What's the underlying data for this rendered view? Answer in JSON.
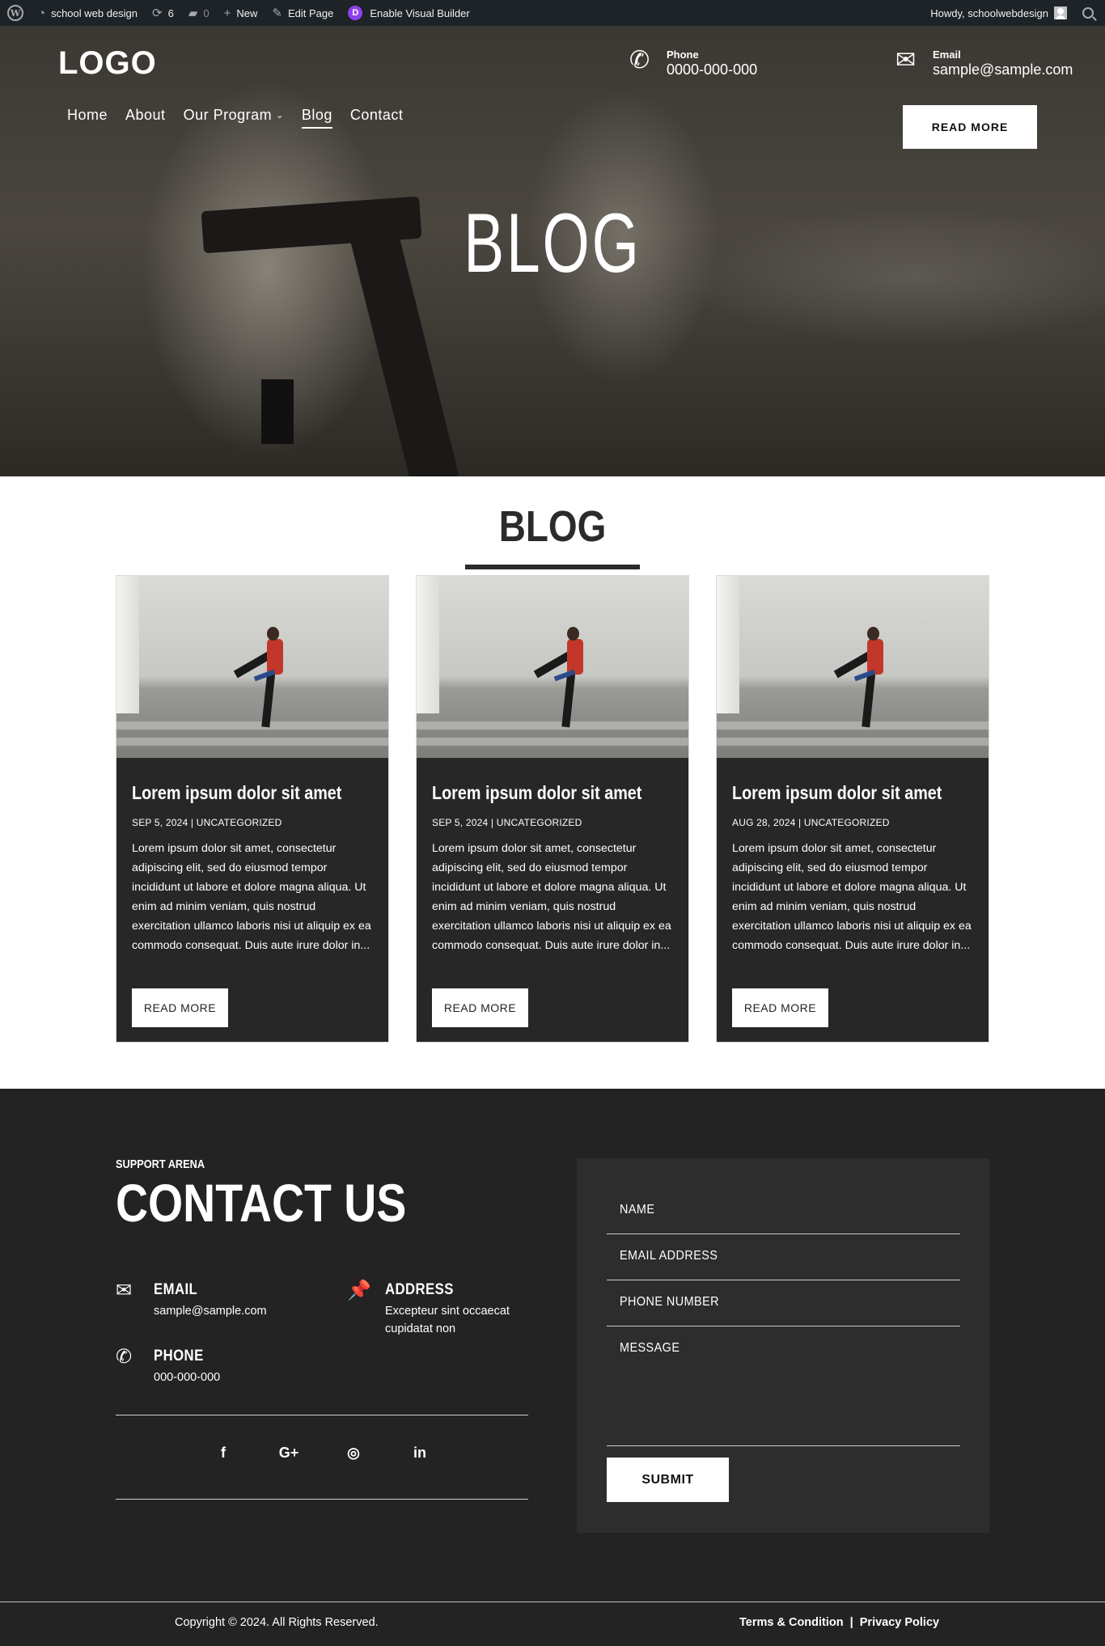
{
  "admin_bar": {
    "site_name": "school web design",
    "updates_count": "6",
    "comments_count": "0",
    "new_label": "New",
    "edit_label": "Edit Page",
    "visual_builder_label": "Enable Visual Builder",
    "greeting": "Howdy, schoolwebdesign"
  },
  "header": {
    "logo": "LOGO",
    "nav": [
      "Home",
      "About",
      "Our Program",
      "Blog",
      "Contact"
    ],
    "active_nav": "Blog",
    "phone_label": "Phone",
    "phone_value": "0000-000-000",
    "email_label": "Email",
    "email_value": "sample@sample.com",
    "cta_label": "READ MORE"
  },
  "hero": {
    "title": "BLOG"
  },
  "blog": {
    "heading": "BLOG",
    "posts": [
      {
        "title": "Lorem ipsum dolor sit amet",
        "date": "SEP 5, 2024",
        "category": "UNCATEGORIZED",
        "excerpt": "Lorem ipsum dolor sit amet, consectetur adipiscing elit, sed do eiusmod tempor incididunt ut labore et dolore magna aliqua. Ut enim ad minim veniam, quis nostrud exercitation ullamco laboris nisi ut aliquip ex ea commodo consequat. Duis aute irure dolor in...",
        "button": "READ MORE"
      },
      {
        "title": "Lorem ipsum dolor sit amet",
        "date": "SEP 5, 2024",
        "category": "UNCATEGORIZED",
        "excerpt": "Lorem ipsum dolor sit amet, consectetur adipiscing elit, sed do eiusmod tempor incididunt ut labore et dolore magna aliqua. Ut enim ad minim veniam, quis nostrud exercitation ullamco laboris nisi ut aliquip ex ea commodo consequat. Duis aute irure dolor in...",
        "button": "READ MORE"
      },
      {
        "title": "Lorem ipsum dolor sit amet",
        "date": "AUG 28, 2024",
        "category": "UNCATEGORIZED",
        "excerpt": "Lorem ipsum dolor sit amet, consectetur adipiscing elit, sed do eiusmod tempor incididunt ut labore et dolore magna aliqua. Ut enim ad minim veniam, quis nostrud exercitation ullamco laboris nisi ut aliquip ex ea commodo consequat. Duis aute irure dolor in...",
        "button": "READ MORE"
      }
    ]
  },
  "contact": {
    "eyebrow": "SUPPORT ARENA",
    "title": "CONTACT US",
    "email_heading": "EMAIL",
    "email_value": "sample@sample.com",
    "address_heading": "ADDRESS",
    "address_value": "Excepteur sint occaecat cupidatat non",
    "phone_heading": "PHONE",
    "phone_value": "000-000-000",
    "social_icons": [
      "facebook-icon",
      "google-plus-icon",
      "instagram-icon",
      "linkedin-icon"
    ]
  },
  "form": {
    "name_placeholder": "NAME",
    "email_placeholder": "EMAIL ADDRESS",
    "phone_placeholder": "PHONE NUMBER",
    "message_placeholder": "MESSAGE",
    "submit_label": "SUBMIT"
  },
  "footer": {
    "copyright": "Copyright © 2024. All Rights Reserved.",
    "terms": "Terms & Condition",
    "separator": "|",
    "privacy": "Privacy Policy"
  },
  "colors": {
    "admin_bar": "#1d2327",
    "card_bg": "#272727",
    "footer_bg": "#232323",
    "form_bg": "#2d2d2d",
    "divi_purple": "#8f42ec"
  }
}
